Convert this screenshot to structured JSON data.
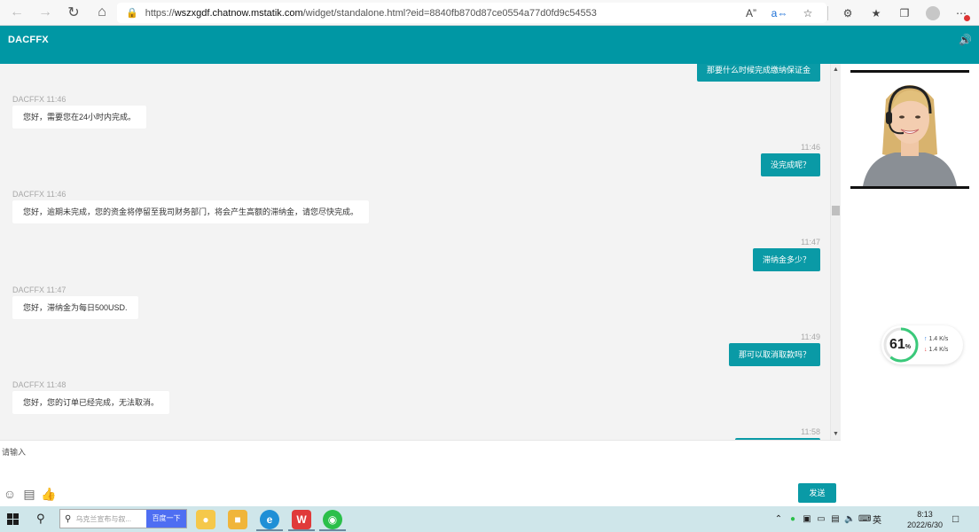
{
  "browser": {
    "url_prefix": "https://",
    "url_host": "wszxgdf.chatnow.mstatik.com",
    "url_path": "/widget/standalone.html?eid=8840fb870d87ce0554a77d0fd9c54553"
  },
  "app": {
    "title": "DACFFX"
  },
  "messages": [
    {
      "text": "那要什么时候完成缴纳保证金"
    },
    {
      "meta": "DACFFX 11:46",
      "text": "您好，需要您在24小时内完成。"
    },
    {
      "meta": "11:46",
      "text": "没完成呢？"
    },
    {
      "meta": "DACFFX 11:46",
      "text": "您好，逾期未完成，您的资金将停留至我司财务部门，将会产生高额的滞纳金，请您尽快完成。"
    },
    {
      "meta": "11:47",
      "text": "滞纳金多少？"
    },
    {
      "meta": "DACFFX 11:47",
      "text": "您好，滞纳金为每日500USD."
    },
    {
      "meta": "11:49",
      "text": "那可以取消取款吗？"
    },
    {
      "meta": "DACFFX 11:48",
      "text": "您好，您的订单已经完成，无法取消。"
    },
    {
      "meta": "11:58"
    }
  ],
  "input": {
    "placeholder": "请输入",
    "send_label": "发送"
  },
  "speed_widget": {
    "percent": "61",
    "percent_unit": "%",
    "upload": "1.4 K/s",
    "download": "1.4 K/s"
  },
  "taskbar": {
    "search_placeholder": "乌克兰宣布与叙...",
    "search_button": "百度一下",
    "ime": "英",
    "time": "8:13",
    "date": "2022/6/30"
  },
  "colors": {
    "accent": "#0097a4",
    "bubble_out": "#0a9aa6"
  }
}
